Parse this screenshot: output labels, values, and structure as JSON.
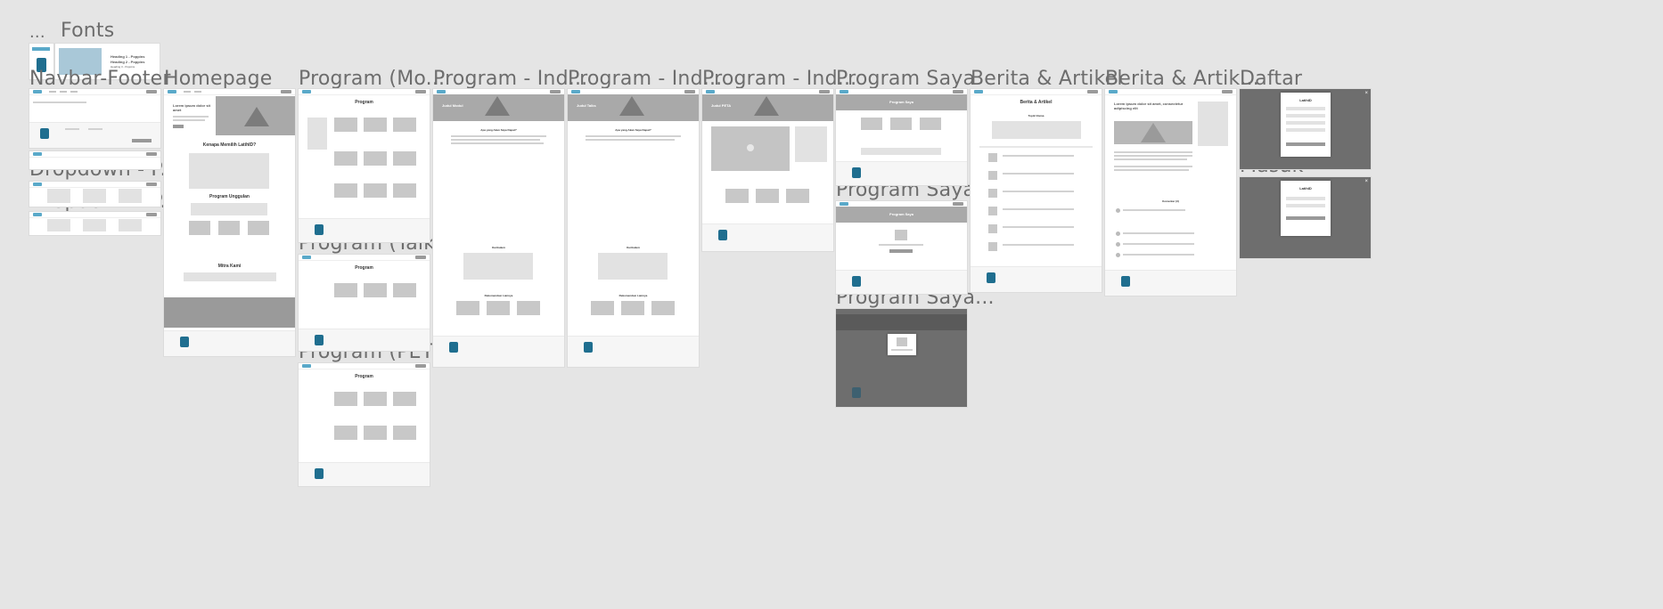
{
  "canvas": {
    "background": "#e5e5e5",
    "overflow_label": "...",
    "fonts_label": "Fonts"
  },
  "frames": [
    {
      "id": "navbar-footer",
      "label": "Navbar-Footer"
    },
    {
      "id": "dropdown-1",
      "label": "Dropdown - P..."
    },
    {
      "id": "dropdown-2",
      "label": "Dropdown - P..."
    },
    {
      "id": "homepage",
      "label": "Homepage"
    },
    {
      "id": "program-mo",
      "label": "Program (Mo..."
    },
    {
      "id": "program-talk",
      "label": "Program (Talk..."
    },
    {
      "id": "program-pet",
      "label": "Program (PET..."
    },
    {
      "id": "program-ind-1",
      "label": "Program - Ind..."
    },
    {
      "id": "program-ind-2",
      "label": "Program - Ind..."
    },
    {
      "id": "program-ind-3",
      "label": "Program - Ind..."
    },
    {
      "id": "program-saya",
      "label": "Program Saya"
    },
    {
      "id": "program-saya-2",
      "label": "Program Saya..."
    },
    {
      "id": "program-saya-3",
      "label": "Program Saya..."
    },
    {
      "id": "berita-artikel",
      "label": "Berita & Artikel"
    },
    {
      "id": "berita-artikel-2",
      "label": "Berita & Artik..."
    },
    {
      "id": "daftar",
      "label": "Daftar"
    },
    {
      "id": "masuk",
      "label": "Masuk"
    }
  ],
  "fonts_card": {
    "heading_1": "Heading 1 - Poppins",
    "heading_2": "Heading 2 - Poppins",
    "heading_3": "Heading 3 - Poppins"
  },
  "homepage": {
    "hero_title": "Lorem ipsum dolor sit amet",
    "section_1": "Kenapa Memilih LatihID?",
    "section_2": "Program Unggulan",
    "section_3": "Mitra Kami"
  },
  "program_page": {
    "title": "Program"
  },
  "program_detail": {
    "title_1": "Judul Modul",
    "title_2": "Judul Talks",
    "title_3": "Judul PETA",
    "q1": "Apa yang Akan Saya Dapat?",
    "kurikulum": "Kurikulum",
    "rekomendasi": "Rekomendasi Lainnya"
  },
  "program_saya": {
    "title": "Program Saya"
  },
  "berita": {
    "title": "Berita & Artikel",
    "topik": "Topik Utama",
    "article_title": "Lorem ipsum dolor sit amet, consectetur adipiscing elit",
    "komentar": "Komentar (3)"
  },
  "auth": {
    "brand": "LatihID",
    "submit": "Daftar"
  },
  "colors": {
    "placeholder": "#a9a9a9",
    "brand": "#1f6e8f",
    "accent": "#5aa9c9",
    "modal_overlay": "#6e6e6e"
  }
}
